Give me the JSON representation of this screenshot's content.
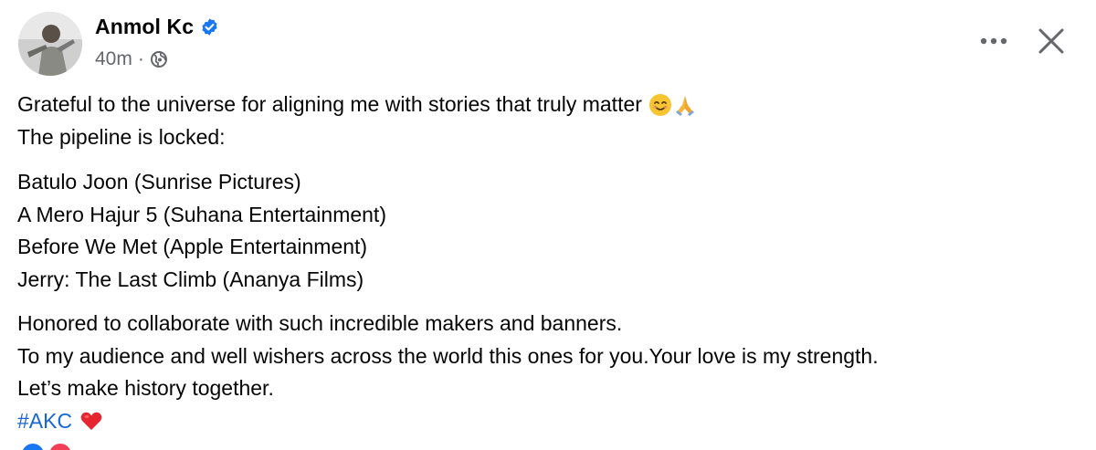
{
  "post": {
    "author": {
      "name": "Anmol Kc",
      "verified": true
    },
    "meta": {
      "time": "40m",
      "separator": "·",
      "audience_icon": "globe-icon"
    },
    "header_actions": {
      "more_icon": "more-horizontal-icon",
      "close_icon": "close-icon"
    },
    "body": {
      "paragraph1": [
        "Grateful to the universe for aligning me with stories that truly matter",
        "The pipeline is locked:"
      ],
      "paragraph2": [
        "Batulo Joon (Sunrise Pictures)",
        "A Mero Hajur 5 (Suhana Entertainment)",
        "Before We Met (Apple Entertainment)",
        "Jerry: The Last Climb (Ananya Films)"
      ],
      "paragraph3": [
        "Honored to collaborate with such incredible makers and banners.",
        "To my audience and well wishers across the world this ones for you.Your love is my strength.",
        "Let’s make history together."
      ],
      "hashtag": "#AKC",
      "emojis": [
        "smiling-face-emoji",
        "folded-hands-emoji",
        "red-heart-emoji"
      ]
    },
    "reactions": [
      "like-reaction-icon",
      "love-reaction-icon"
    ]
  },
  "colors": {
    "text": "#050505",
    "secondary_text": "#65676b",
    "hashtag": "#1866d4",
    "verified_badge": "#1877f2"
  }
}
